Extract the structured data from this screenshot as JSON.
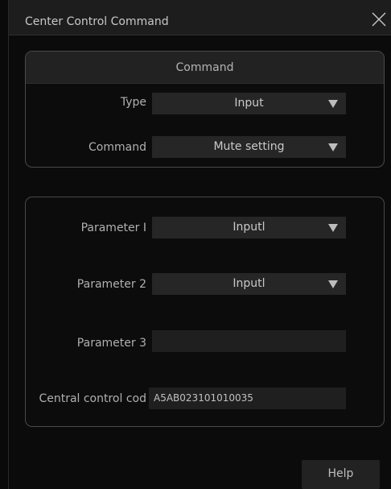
{
  "window": {
    "title": "Center Control Command"
  },
  "command_group": {
    "header": "Command",
    "type_label": "Type",
    "type_value": "Input",
    "command_label": "Command",
    "command_value": "Mute setting"
  },
  "parameter_group": {
    "param1_label": "Parameter I",
    "param1_value": "Inputl",
    "param2_label": "Parameter 2",
    "param2_value": "Inputl",
    "param3_label": "Parameter 3",
    "param3_value": "",
    "code_label": "Central control cod",
    "code_value": "A5AB023101010035"
  },
  "footer": {
    "help_label": "Help"
  },
  "icons": {
    "close": "close-icon",
    "dropdown": "chevron-down-icon"
  }
}
